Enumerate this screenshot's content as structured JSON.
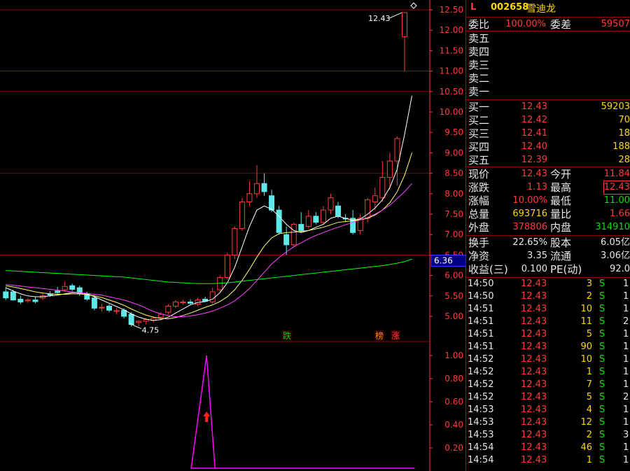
{
  "stock": {
    "flag": "L",
    "code": "002658",
    "name": "雪迪龙"
  },
  "colors": {
    "up": "#ff3b3b",
    "down": "#5fe8e8",
    "ma5": "#ffffff",
    "ma10": "#ffff66",
    "ma20": "#ff44ff",
    "ma60": "#00ff00",
    "grid": "#8b0000",
    "axis": "#ff3b3b"
  },
  "chart_data": [
    {
      "type": "candlestick",
      "title": "",
      "y_ticks": [
        "12.50",
        "12.00",
        "11.50",
        "11.00",
        "10.50",
        "10.00",
        "9.50",
        "9.00",
        "8.50",
        "8.00",
        "7.50",
        "7.00",
        "6.50",
        "6.00",
        "5.50",
        "5.00"
      ],
      "ylim": [
        4.55,
        12.8
      ],
      "current_price_label": "6.36",
      "annotations": {
        "high_label": "12.43",
        "low_label": "4.75",
        "marks": [
          "跌",
          "榜",
          "涨"
        ]
      },
      "candles": [
        {
          "o": 5.6,
          "h": 5.72,
          "l": 5.4,
          "c": 5.45
        },
        {
          "o": 5.6,
          "h": 5.65,
          "l": 5.38,
          "c": 5.4
        },
        {
          "o": 5.42,
          "h": 5.5,
          "l": 5.3,
          "c": 5.35
        },
        {
          "o": 5.38,
          "h": 5.45,
          "l": 5.33,
          "c": 5.4
        },
        {
          "o": 5.4,
          "h": 5.48,
          "l": 5.32,
          "c": 5.36
        },
        {
          "o": 5.45,
          "h": 5.55,
          "l": 5.4,
          "c": 5.5
        },
        {
          "o": 5.55,
          "h": 5.62,
          "l": 5.48,
          "c": 5.52
        },
        {
          "o": 5.62,
          "h": 5.72,
          "l": 5.55,
          "c": 5.58
        },
        {
          "o": 5.65,
          "h": 5.85,
          "l": 5.6,
          "c": 5.73
        },
        {
          "o": 5.75,
          "h": 5.8,
          "l": 5.62,
          "c": 5.66
        },
        {
          "o": 5.7,
          "h": 5.75,
          "l": 5.5,
          "c": 5.55
        },
        {
          "o": 5.55,
          "h": 5.6,
          "l": 5.38,
          "c": 5.42
        },
        {
          "o": 5.45,
          "h": 5.5,
          "l": 5.15,
          "c": 5.2
        },
        {
          "o": 5.22,
          "h": 5.3,
          "l": 5.12,
          "c": 5.22
        },
        {
          "o": 5.25,
          "h": 5.3,
          "l": 5.1,
          "c": 5.15
        },
        {
          "o": 5.12,
          "h": 5.2,
          "l": 5.05,
          "c": 5.14
        },
        {
          "o": 5.15,
          "h": 5.2,
          "l": 4.95,
          "c": 5.0
        },
        {
          "o": 5.05,
          "h": 5.1,
          "l": 4.75,
          "c": 4.8
        },
        {
          "o": 4.85,
          "h": 4.9,
          "l": 4.76,
          "c": 4.88
        },
        {
          "o": 4.88,
          "h": 4.95,
          "l": 4.8,
          "c": 4.92
        },
        {
          "o": 4.9,
          "h": 5.0,
          "l": 4.85,
          "c": 4.95
        },
        {
          "o": 4.98,
          "h": 5.1,
          "l": 4.9,
          "c": 5.05
        },
        {
          "o": 5.1,
          "h": 5.3,
          "l": 5.05,
          "c": 5.25
        },
        {
          "o": 5.25,
          "h": 5.4,
          "l": 5.2,
          "c": 5.35
        },
        {
          "o": 5.35,
          "h": 5.4,
          "l": 5.28,
          "c": 5.35
        },
        {
          "o": 5.35,
          "h": 5.42,
          "l": 5.28,
          "c": 5.32
        },
        {
          "o": 5.3,
          "h": 5.45,
          "l": 5.25,
          "c": 5.4
        },
        {
          "o": 5.42,
          "h": 5.48,
          "l": 5.35,
          "c": 5.37
        },
        {
          "o": 5.35,
          "h": 5.7,
          "l": 5.3,
          "c": 5.6
        },
        {
          "o": 5.65,
          "h": 6.0,
          "l": 5.6,
          "c": 5.95
        },
        {
          "o": 5.95,
          "h": 6.55,
          "l": 5.9,
          "c": 6.5
        },
        {
          "o": 6.5,
          "h": 7.2,
          "l": 6.4,
          "c": 7.15
        },
        {
          "o": 7.15,
          "h": 7.9,
          "l": 7.1,
          "c": 7.8
        },
        {
          "o": 7.8,
          "h": 8.3,
          "l": 7.7,
          "c": 8.0
        },
        {
          "o": 8.0,
          "h": 8.7,
          "l": 7.9,
          "c": 8.25
        },
        {
          "o": 8.25,
          "h": 8.5,
          "l": 7.95,
          "c": 8.05
        },
        {
          "o": 7.95,
          "h": 8.1,
          "l": 7.55,
          "c": 7.6
        },
        {
          "o": 7.6,
          "h": 7.7,
          "l": 7.0,
          "c": 7.05
        },
        {
          "o": 7.0,
          "h": 7.2,
          "l": 6.5,
          "c": 6.75
        },
        {
          "o": 6.75,
          "h": 7.3,
          "l": 6.7,
          "c": 7.25
        },
        {
          "o": 7.25,
          "h": 7.55,
          "l": 7.05,
          "c": 7.1
        },
        {
          "o": 7.2,
          "h": 7.6,
          "l": 7.15,
          "c": 7.45
        },
        {
          "o": 7.45,
          "h": 7.55,
          "l": 7.25,
          "c": 7.3
        },
        {
          "o": 7.3,
          "h": 7.7,
          "l": 7.25,
          "c": 7.6
        },
        {
          "o": 7.6,
          "h": 8.0,
          "l": 7.5,
          "c": 7.9
        },
        {
          "o": 7.7,
          "h": 7.8,
          "l": 7.4,
          "c": 7.45
        },
        {
          "o": 7.4,
          "h": 7.5,
          "l": 7.3,
          "c": 7.38
        },
        {
          "o": 7.4,
          "h": 7.6,
          "l": 7.0,
          "c": 7.05
        },
        {
          "o": 7.1,
          "h": 7.5,
          "l": 7.0,
          "c": 7.4
        },
        {
          "o": 7.4,
          "h": 7.9,
          "l": 7.3,
          "c": 7.85
        },
        {
          "o": 7.8,
          "h": 8.15,
          "l": 7.6,
          "c": 7.95
        },
        {
          "o": 7.9,
          "h": 8.8,
          "l": 7.8,
          "c": 8.4
        },
        {
          "o": 8.4,
          "h": 9.0,
          "l": 8.1,
          "c": 8.8
        },
        {
          "o": 8.8,
          "h": 9.4,
          "l": 8.2,
          "c": 9.35
        },
        {
          "o": 11.84,
          "h": 12.43,
          "l": 11.0,
          "c": 12.43
        }
      ],
      "ma": {
        "MA5": [
          5.7,
          5.62,
          5.55,
          5.5,
          5.48,
          5.48,
          5.5,
          5.52,
          5.55,
          5.58,
          5.58,
          5.55,
          5.48,
          5.4,
          5.32,
          5.24,
          5.16,
          5.06,
          4.98,
          4.93,
          4.9,
          4.92,
          4.98,
          5.08,
          5.18,
          5.28,
          5.34,
          5.36,
          5.42,
          5.58,
          5.82,
          6.2,
          6.7,
          7.2,
          7.6,
          7.7,
          7.62,
          7.45,
          7.25,
          7.1,
          7.05,
          7.1,
          7.18,
          7.25,
          7.4,
          7.45,
          7.4,
          7.35,
          7.38,
          7.5,
          7.65,
          7.85,
          8.15,
          8.6,
          9.45,
          10.4
        ],
        "MA10": [
          5.75,
          5.72,
          5.68,
          5.64,
          5.6,
          5.57,
          5.55,
          5.54,
          5.54,
          5.55,
          5.55,
          5.53,
          5.5,
          5.46,
          5.4,
          5.34,
          5.27,
          5.18,
          5.1,
          5.03,
          4.98,
          4.95,
          4.94,
          4.97,
          5.02,
          5.08,
          5.15,
          5.22,
          5.28,
          5.36,
          5.48,
          5.65,
          5.88,
          6.15,
          6.45,
          6.72,
          6.92,
          7.02,
          7.05,
          7.06,
          7.08,
          7.1,
          7.14,
          7.18,
          7.24,
          7.3,
          7.32,
          7.34,
          7.36,
          7.4,
          7.48,
          7.6,
          7.78,
          8.05,
          8.45,
          9.0
        ],
        "MA20": [
          5.78,
          5.76,
          5.74,
          5.72,
          5.7,
          5.68,
          5.66,
          5.64,
          5.62,
          5.6,
          5.58,
          5.56,
          5.54,
          5.52,
          5.48,
          5.44,
          5.4,
          5.34,
          5.28,
          5.2,
          5.12,
          5.06,
          5.02,
          4.99,
          4.99,
          5.01,
          5.04,
          5.08,
          5.13,
          5.2,
          5.28,
          5.38,
          5.52,
          5.68,
          5.88,
          6.08,
          6.28,
          6.44,
          6.58,
          6.7,
          6.8,
          6.9,
          6.98,
          7.05,
          7.12,
          7.18,
          7.24,
          7.3,
          7.36,
          7.42,
          7.5,
          7.6,
          7.72,
          7.88,
          8.05,
          8.25
        ],
        "MA60": [
          6.12,
          6.11,
          6.1,
          6.09,
          6.08,
          6.07,
          6.06,
          6.05,
          6.04,
          6.03,
          6.02,
          6.01,
          6.0,
          5.99,
          5.98,
          5.97,
          5.96,
          5.94,
          5.92,
          5.9,
          5.88,
          5.86,
          5.84,
          5.83,
          5.82,
          5.81,
          5.8,
          5.8,
          5.8,
          5.81,
          5.82,
          5.84,
          5.86,
          5.88,
          5.9,
          5.92,
          5.94,
          5.96,
          5.98,
          6.0,
          6.02,
          6.04,
          6.06,
          6.08,
          6.1,
          6.12,
          6.14,
          6.16,
          6.18,
          6.2,
          6.22,
          6.24,
          6.27,
          6.3,
          6.34,
          6.4
        ]
      }
    },
    {
      "type": "line",
      "title": "",
      "y_ticks": [
        "1.00",
        "0.80",
        "0.60",
        "0.40",
        "0.20"
      ],
      "ylim": [
        -0.25,
        1.05
      ],
      "signal_index": 27,
      "line_start_index": 25,
      "values_note": "spike from 0 to 1.00 at signal bar",
      "values": [
        0,
        0,
        1.0,
        0,
        0,
        0,
        0,
        0,
        0,
        0,
        0,
        0,
        0,
        0,
        0,
        0,
        0,
        0,
        0,
        0,
        0,
        0,
        0,
        0,
        0,
        0,
        0,
        0,
        0,
        0,
        0
      ]
    }
  ],
  "quote": {
    "rows1": [
      {
        "l": "委比",
        "v": "100.00%",
        "l2": "委差",
        "v2": "59507"
      }
    ],
    "asks": [
      "卖五",
      "卖四",
      "卖三",
      "卖二",
      "卖一"
    ],
    "bids": [
      {
        "l": "买一",
        "p": "12.43",
        "q": "59203"
      },
      {
        "l": "买二",
        "p": "12.42",
        "q": "70"
      },
      {
        "l": "买三",
        "p": "12.41",
        "q": "18"
      },
      {
        "l": "买四",
        "p": "12.40",
        "q": "188"
      },
      {
        "l": "买五",
        "p": "12.39",
        "q": "28"
      }
    ],
    "stats": [
      {
        "l": "现价",
        "v": "12.43",
        "l2": "今开",
        "v2": "11.84"
      },
      {
        "l": "涨跌",
        "v": "1.13",
        "l2": "最高",
        "v2": "12.43"
      },
      {
        "l": "涨幅",
        "v": "10.00%",
        "l2": "最低",
        "v2": "11.00"
      },
      {
        "l": "总量",
        "v": "693716",
        "l2": "量比",
        "v2": "1.66"
      },
      {
        "l": "外盘",
        "v": "378806",
        "l2": "内盘",
        "v2": "314910"
      }
    ],
    "stats2": [
      {
        "l": "换手",
        "v": "22.65%",
        "l2": "股本",
        "v2": "6.05亿"
      },
      {
        "l": "净资",
        "v": "3.35",
        "l2": "流通",
        "v2": "3.06亿"
      },
      {
        "l": "收益(三)",
        "v": "0.100",
        "l2": "PE(动)",
        "v2": "92.0"
      }
    ],
    "ticks": [
      {
        "t": "14:50",
        "p": "12.43",
        "q": "3",
        "s": "S",
        "n": "1"
      },
      {
        "t": "14:50",
        "p": "12.43",
        "q": "2",
        "s": "S",
        "n": "1"
      },
      {
        "t": "14:51",
        "p": "12.43",
        "q": "10",
        "s": "S",
        "n": "1"
      },
      {
        "t": "14:51",
        "p": "12.43",
        "q": "11",
        "s": "S",
        "n": "2"
      },
      {
        "t": "14:51",
        "p": "12.43",
        "q": "5",
        "s": "S",
        "n": "1"
      },
      {
        "t": "14:51",
        "p": "12.43",
        "q": "90",
        "s": "S",
        "n": "1"
      },
      {
        "t": "14:52",
        "p": "12.43",
        "q": "10",
        "s": "S",
        "n": "1"
      },
      {
        "t": "14:52",
        "p": "12.43",
        "q": "1",
        "s": "S",
        "n": "1"
      },
      {
        "t": "14:52",
        "p": "12.43",
        "q": "7",
        "s": "S",
        "n": "1"
      },
      {
        "t": "14:52",
        "p": "12.43",
        "q": "5",
        "s": "S",
        "n": "2"
      },
      {
        "t": "14:53",
        "p": "12.43",
        "q": "4",
        "s": "S",
        "n": "1"
      },
      {
        "t": "14:53",
        "p": "12.43",
        "q": "12",
        "s": "S",
        "n": "1"
      },
      {
        "t": "14:53",
        "p": "12.43",
        "q": "2",
        "s": "S",
        "n": "3"
      },
      {
        "t": "14:54",
        "p": "12.43",
        "q": "46",
        "s": "S",
        "n": "1"
      },
      {
        "t": "14:54",
        "p": "12.43",
        "q": "1",
        "s": "S",
        "n": "1"
      }
    ]
  }
}
